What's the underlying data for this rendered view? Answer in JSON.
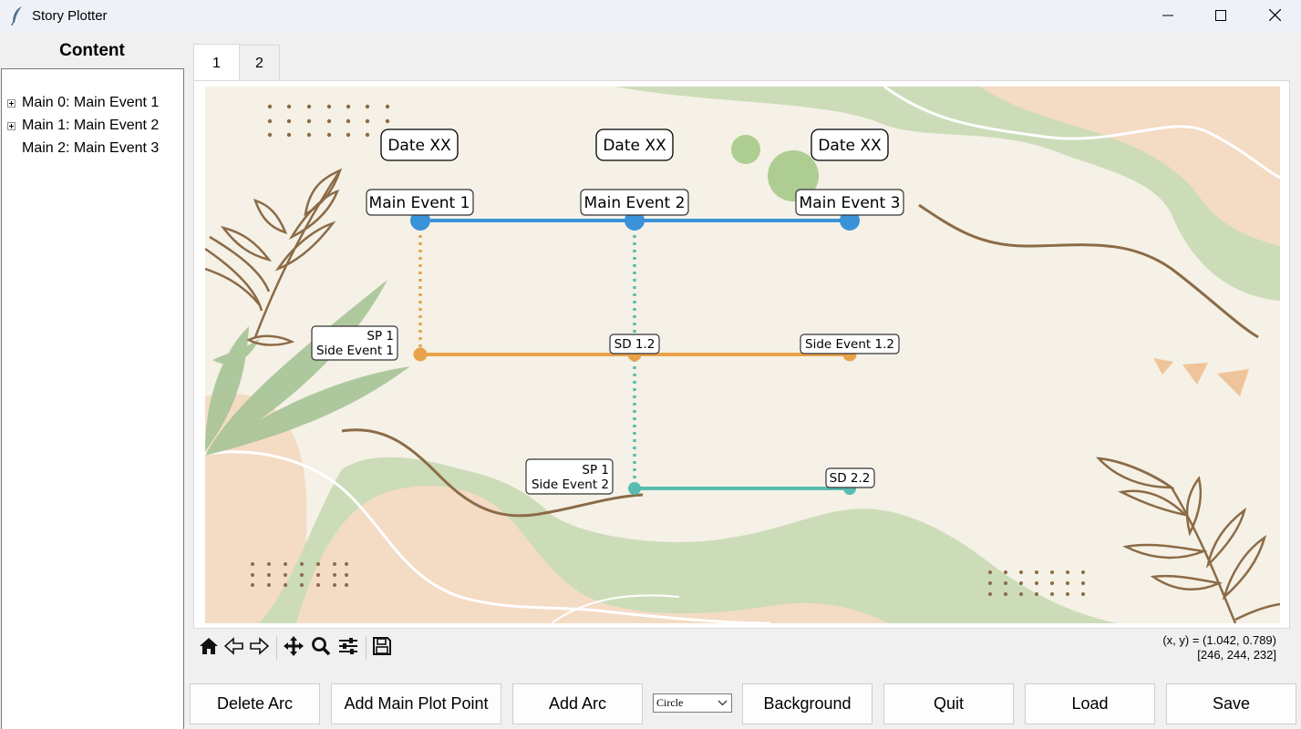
{
  "window": {
    "title": "Story Plotter"
  },
  "sidebar": {
    "title": "Content",
    "items": [
      {
        "label": "Main 0: Main Event 1",
        "expandable": true
      },
      {
        "label": "Main 1: Main Event 2",
        "expandable": true
      },
      {
        "label": "Main 2: Main Event 3",
        "expandable": false
      }
    ]
  },
  "tabs": [
    {
      "label": "1",
      "active": true
    },
    {
      "label": "2",
      "active": false
    }
  ],
  "plot": {
    "dates": [
      "Date XX",
      "Date XX",
      "Date XX"
    ],
    "main_events": [
      "Main Event 1",
      "Main Event 2",
      "Main Event 3"
    ],
    "side_arc_1": {
      "start_label_line1": "SP 1",
      "start_label_line2": "Side Event 1",
      "mid_label": "SD 1.2",
      "end_label": "Side Event 1.2"
    },
    "side_arc_2": {
      "start_label_line1": "SP 1",
      "start_label_line2": "Side Event 2",
      "end_label": "SD 2.2"
    },
    "colors": {
      "main": "#3a93d8",
      "side1": "#e8a24a",
      "side2": "#58bdb0"
    }
  },
  "toolbar": {
    "icons": [
      "home-icon",
      "back-icon",
      "forward-icon",
      "pan-icon",
      "zoom-icon",
      "configure-icon",
      "save-figure-icon"
    ],
    "coords_line1": "(x, y) = (1.042, 0.789)",
    "coords_line2": "[246, 244, 232]"
  },
  "buttons": {
    "delete_arc": "Delete Arc",
    "add_main": "Add Main Plot Point",
    "add_arc": "Add Arc",
    "shape_value": "Circle",
    "background": "Background",
    "quit": "Quit",
    "load": "Load",
    "save": "Save"
  }
}
